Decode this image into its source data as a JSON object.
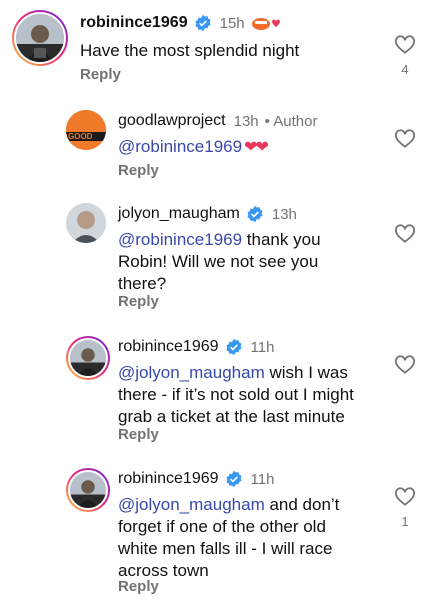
{
  "comments": [
    {
      "username": "robinince1969",
      "time": "15h",
      "text": "Have the most splendid night",
      "reply": "Reply",
      "likes": "4"
    },
    {
      "username": "goodlawproject",
      "time": "13h",
      "author_label": "• Author",
      "mention": "@robinince1969",
      "text": "",
      "reply": "Reply",
      "avatar_text": "GOOD"
    },
    {
      "username": "jolyon_maugham",
      "time": "13h",
      "mention": "@robinince1969",
      "text_1": " thank you",
      "text_2": "Robin! Will we not see you",
      "text_3": "there?",
      "reply": "Reply"
    },
    {
      "username": "robinince1969",
      "time": "11h",
      "mention": "@jolyon_maugham",
      "text_1": " wish I was",
      "text_2": "there - if it’s not sold out I might",
      "text_3": "grab a ticket at the last minute",
      "reply": "Reply"
    },
    {
      "username": "robinince1969",
      "time": "11h",
      "mention": "@jolyon_maugham",
      "text_1": " and don’t",
      "text_2": "forget if one of the other old",
      "text_3": "white men falls ill - I will race",
      "text_4": "across town",
      "reply": "Reply",
      "likes": "1"
    }
  ],
  "icons": {
    "like": "heart-outline-icon",
    "verified": "verified-badge-icon",
    "hearts_emoji": "❤❤"
  },
  "colors": {
    "mention": "#3949ab",
    "verified": "#3897f0",
    "muted": "#737373",
    "heart": "#e8375d"
  }
}
